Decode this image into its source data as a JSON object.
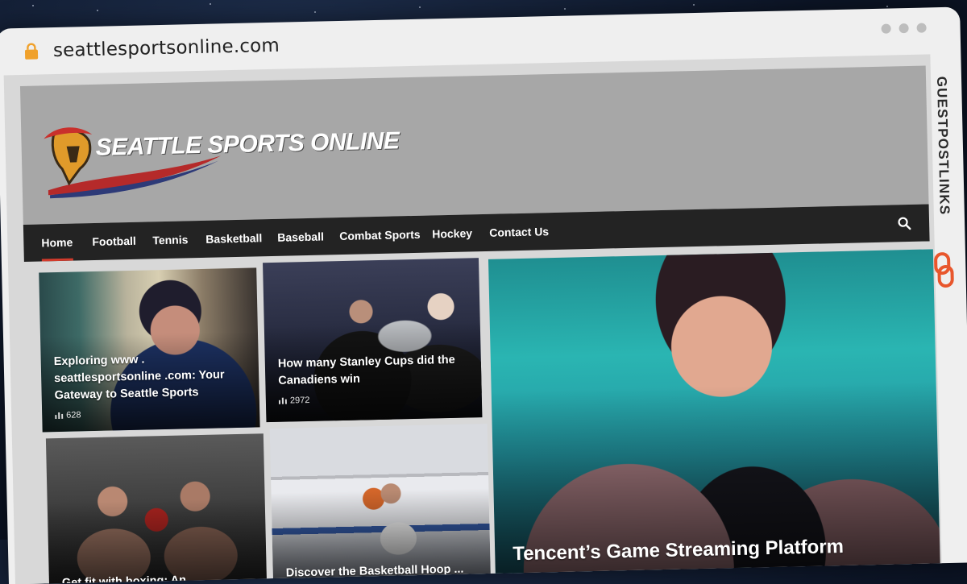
{
  "browser": {
    "url": "seattlesportsonline.com",
    "side_brand": "GUESTPOSTLINKS"
  },
  "site": {
    "logo_text": "SEATTLE SPORTS ONLINE"
  },
  "nav": {
    "items": [
      "Home",
      "Football",
      "Tennis",
      "Basketball",
      "Baseball",
      "Combat Sports",
      "Hockey",
      "Contact Us"
    ],
    "active": "Home"
  },
  "cards": [
    {
      "title": "Exploring www . seattlesportsonline .com: Your Gateway to Seattle Sports",
      "views": "628"
    },
    {
      "title": "How many Stanley Cups did the Canadiens win",
      "views": "2972"
    },
    {
      "title": "Get fit with boxing: An introduction",
      "views": ""
    },
    {
      "title": "Discover the Basketball Hoop ... Shop Just in Farm Country",
      "views": ""
    },
    {
      "title": "Tencent’s Game Streaming Platform",
      "views": ""
    }
  ],
  "colors": {
    "nav_bg": "#232323",
    "active_underline": "#d23b2c",
    "header_bg": "#a7a7a7",
    "lock_icon": "#f0a12b",
    "side_brand_icon": "#e8562c"
  }
}
